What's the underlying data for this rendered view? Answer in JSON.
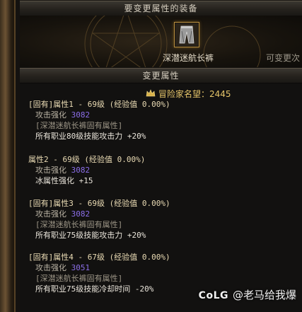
{
  "header": {
    "title": "要变更属性的装备"
  },
  "equipment": {
    "item_icon": "pants-icon",
    "item_name": "深潜迷航长裤",
    "changeable_label": "可变更次"
  },
  "section": {
    "title": "变更属性"
  },
  "fame": {
    "icon": "fame-crown-icon",
    "label": "冒险家名望：2445"
  },
  "attributes": [
    {
      "title": "[固有]属性1 - 69级 (经验值 0.00%)",
      "stat_label": "攻击强化",
      "stat_value": "3082",
      "fixed_note": "[深潜迷航长裤固有属性]",
      "effect": "所有职业80级技能攻击力 +20%"
    },
    {
      "title": "属性2 - 69级 (经验值 0.00%)",
      "stat_label": "攻击强化",
      "stat_value": "3082",
      "effect": "冰属性强化 +15"
    },
    {
      "title": "[固有]属性3 - 69级 (经验值 0.00%)",
      "stat_label": "攻击强化",
      "stat_value": "3082",
      "fixed_note": "[深潜迷航长裤固有属性]",
      "effect": "所有职业75级技能攻击力 +20%"
    },
    {
      "title": "[固有]属性4 - 67级 (经验值 0.00%)",
      "stat_label": "攻击强化",
      "stat_value": "3051",
      "fixed_note": "[深潜迷航长裤固有属性]",
      "effect": "所有职业75级技能冷却时间 -20%"
    }
  ],
  "watermark": {
    "logo": "CoLG",
    "text": "@老马给我爆"
  },
  "colors": {
    "gold": "#e5c56a",
    "purple_value": "#8b6ee8",
    "grey_note": "#9c9586"
  }
}
